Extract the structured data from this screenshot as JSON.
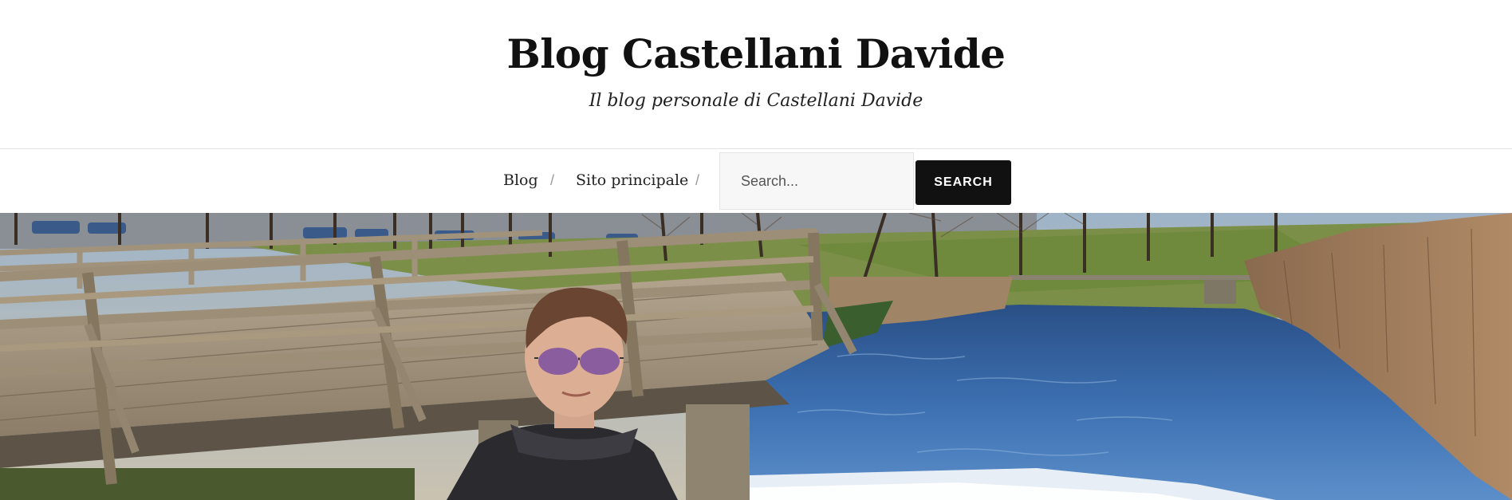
{
  "header": {
    "title": "Blog Castellani Davide",
    "tagline": "Il blog personale di Castellani Davide"
  },
  "nav": {
    "items": [
      {
        "label": "Blog"
      },
      {
        "label": "Sito principale"
      }
    ],
    "separator": "/"
  },
  "search": {
    "placeholder": "Search...",
    "value": "",
    "button_label": "SEARCH"
  },
  "hero": {
    "alt": "Ragazzo con occhiali da sole vicino a un ponte di legno e un fiume"
  },
  "colors": {
    "accent": "#111111",
    "background": "#ffffff",
    "search_bg": "#f7f7f7"
  }
}
